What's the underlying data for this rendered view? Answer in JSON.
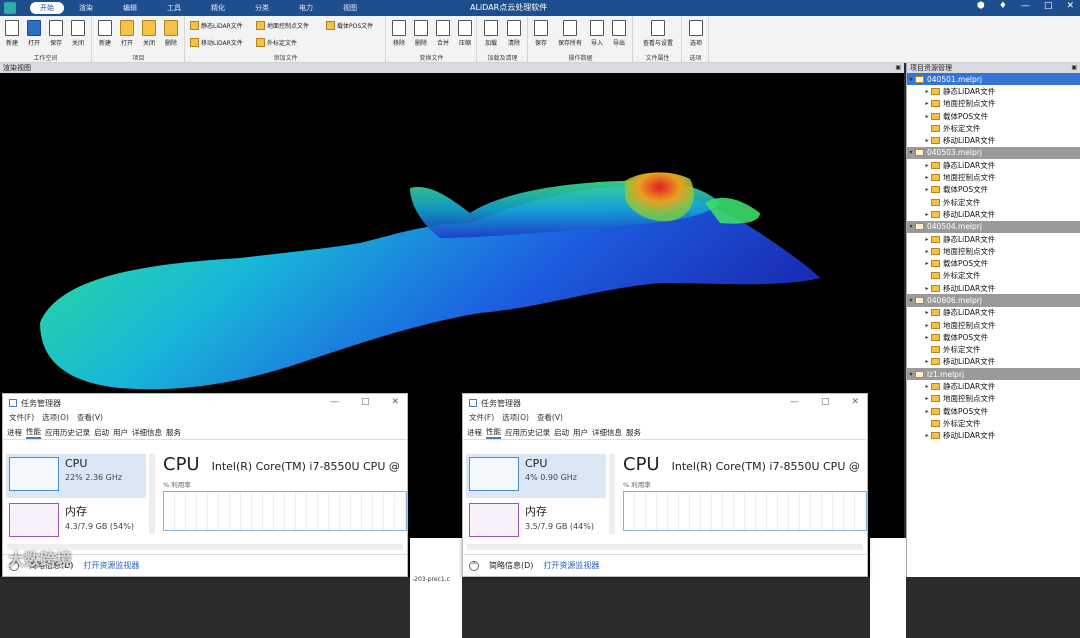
{
  "titlebar": {
    "title": "ALiDAR点云处理软件",
    "menu": [
      "开始",
      "渲染",
      "编辑",
      "工具",
      "精化",
      "分类",
      "电力",
      "视图"
    ],
    "controls": [
      "⬢",
      "♦",
      "—",
      "□",
      "✕"
    ]
  },
  "ribbon": {
    "project_group": {
      "label": "工作空间",
      "buttons": [
        "新建",
        "打开",
        "保存",
        "关闭"
      ]
    },
    "item_group": {
      "label": "项目",
      "buttons": [
        "新建",
        "打开",
        "关闭",
        "删除"
      ]
    },
    "add_group": {
      "label": "添加文件",
      "items": [
        "静态LiDAR文件",
        "地面控制点文件",
        "载体POS文件",
        "移动LiDAR文件",
        "外标定文件"
      ]
    },
    "transform_group": {
      "label": "变换文件",
      "buttons": [
        "移除",
        "删除",
        "合并",
        "压缩"
      ]
    },
    "load_group": {
      "label": "加载及清理",
      "buttons": [
        "加载",
        "清除"
      ]
    },
    "op_group": {
      "label": "操作数据",
      "buttons": [
        "保存",
        "保存所有",
        "导入",
        "导出"
      ]
    },
    "file_group": {
      "label": "文件属性",
      "buttons": [
        "查看与设置"
      ]
    },
    "opt_group": {
      "label": "选项",
      "buttons": [
        "选项"
      ]
    }
  },
  "viewport": {
    "title": "渲染视图"
  },
  "panel": {
    "title": "项目资源管理",
    "projects": [
      {
        "name": "040501.melprj",
        "children": [
          "静态LiDAR文件",
          "地面控制点文件",
          "载体POS文件",
          "外标定文件",
          "移动LiDAR文件"
        ]
      },
      {
        "name": "040503.melprj",
        "children": [
          "静态LiDAR文件",
          "地面控制点文件",
          "载体POS文件",
          "外标定文件",
          "移动LiDAR文件"
        ]
      },
      {
        "name": "040504.melprj",
        "children": [
          "静态LiDAR文件",
          "地面控制点文件",
          "载体POS文件",
          "外标定文件",
          "移动LiDAR文件"
        ]
      },
      {
        "name": "040606.melprj",
        "children": [
          "静态LiDAR文件",
          "地面控制点文件",
          "载体POS文件",
          "外标定文件",
          "移动LiDAR文件"
        ]
      },
      {
        "name": "lz1.melprj",
        "children": [
          "静态LiDAR文件",
          "地面控制点文件",
          "载体POS文件",
          "外标定文件",
          "移动LiDAR文件"
        ]
      }
    ]
  },
  "taskmgr_left": {
    "title": "任务管理器",
    "menu": [
      "文件(F)",
      "选项(O)",
      "查看(V)"
    ],
    "tabs": [
      "进程",
      "性能",
      "应用历史记录",
      "启动",
      "用户",
      "详细信息",
      "服务"
    ],
    "cpu_label": "CPU",
    "cpu_value": "22% 2.36 GHz",
    "mem_label": "内存",
    "mem_value": "4.3/7.9 GB (54%)",
    "main_title": "CPU",
    "model": "Intel(R) Core(TM) i7-8550U CPU @",
    "util": "% 利用率",
    "footer_less": "简略信息(D)",
    "footer_link": "打开资源监视器"
  },
  "taskmgr_right": {
    "title": "任务管理器",
    "menu": [
      "文件(F)",
      "选项(O)",
      "查看(V)"
    ],
    "tabs": [
      "进程",
      "性能",
      "应用历史记录",
      "启动",
      "用户",
      "详细信息",
      "服务"
    ],
    "cpu_label": "CPU",
    "cpu_value": "4% 0.90 GHz",
    "mem_label": "内存",
    "mem_value": "3.5/7.9 GB (44%)",
    "main_title": "CPU",
    "model": "Intel(R) Core(TM) i7-8550U CPU @",
    "util": "% 利用率",
    "footer_less": "简略信息(D)",
    "footer_link": "打开资源监视器"
  },
  "console": {
    "text": "-203-prec1.c"
  },
  "watermark": "大数跨境"
}
